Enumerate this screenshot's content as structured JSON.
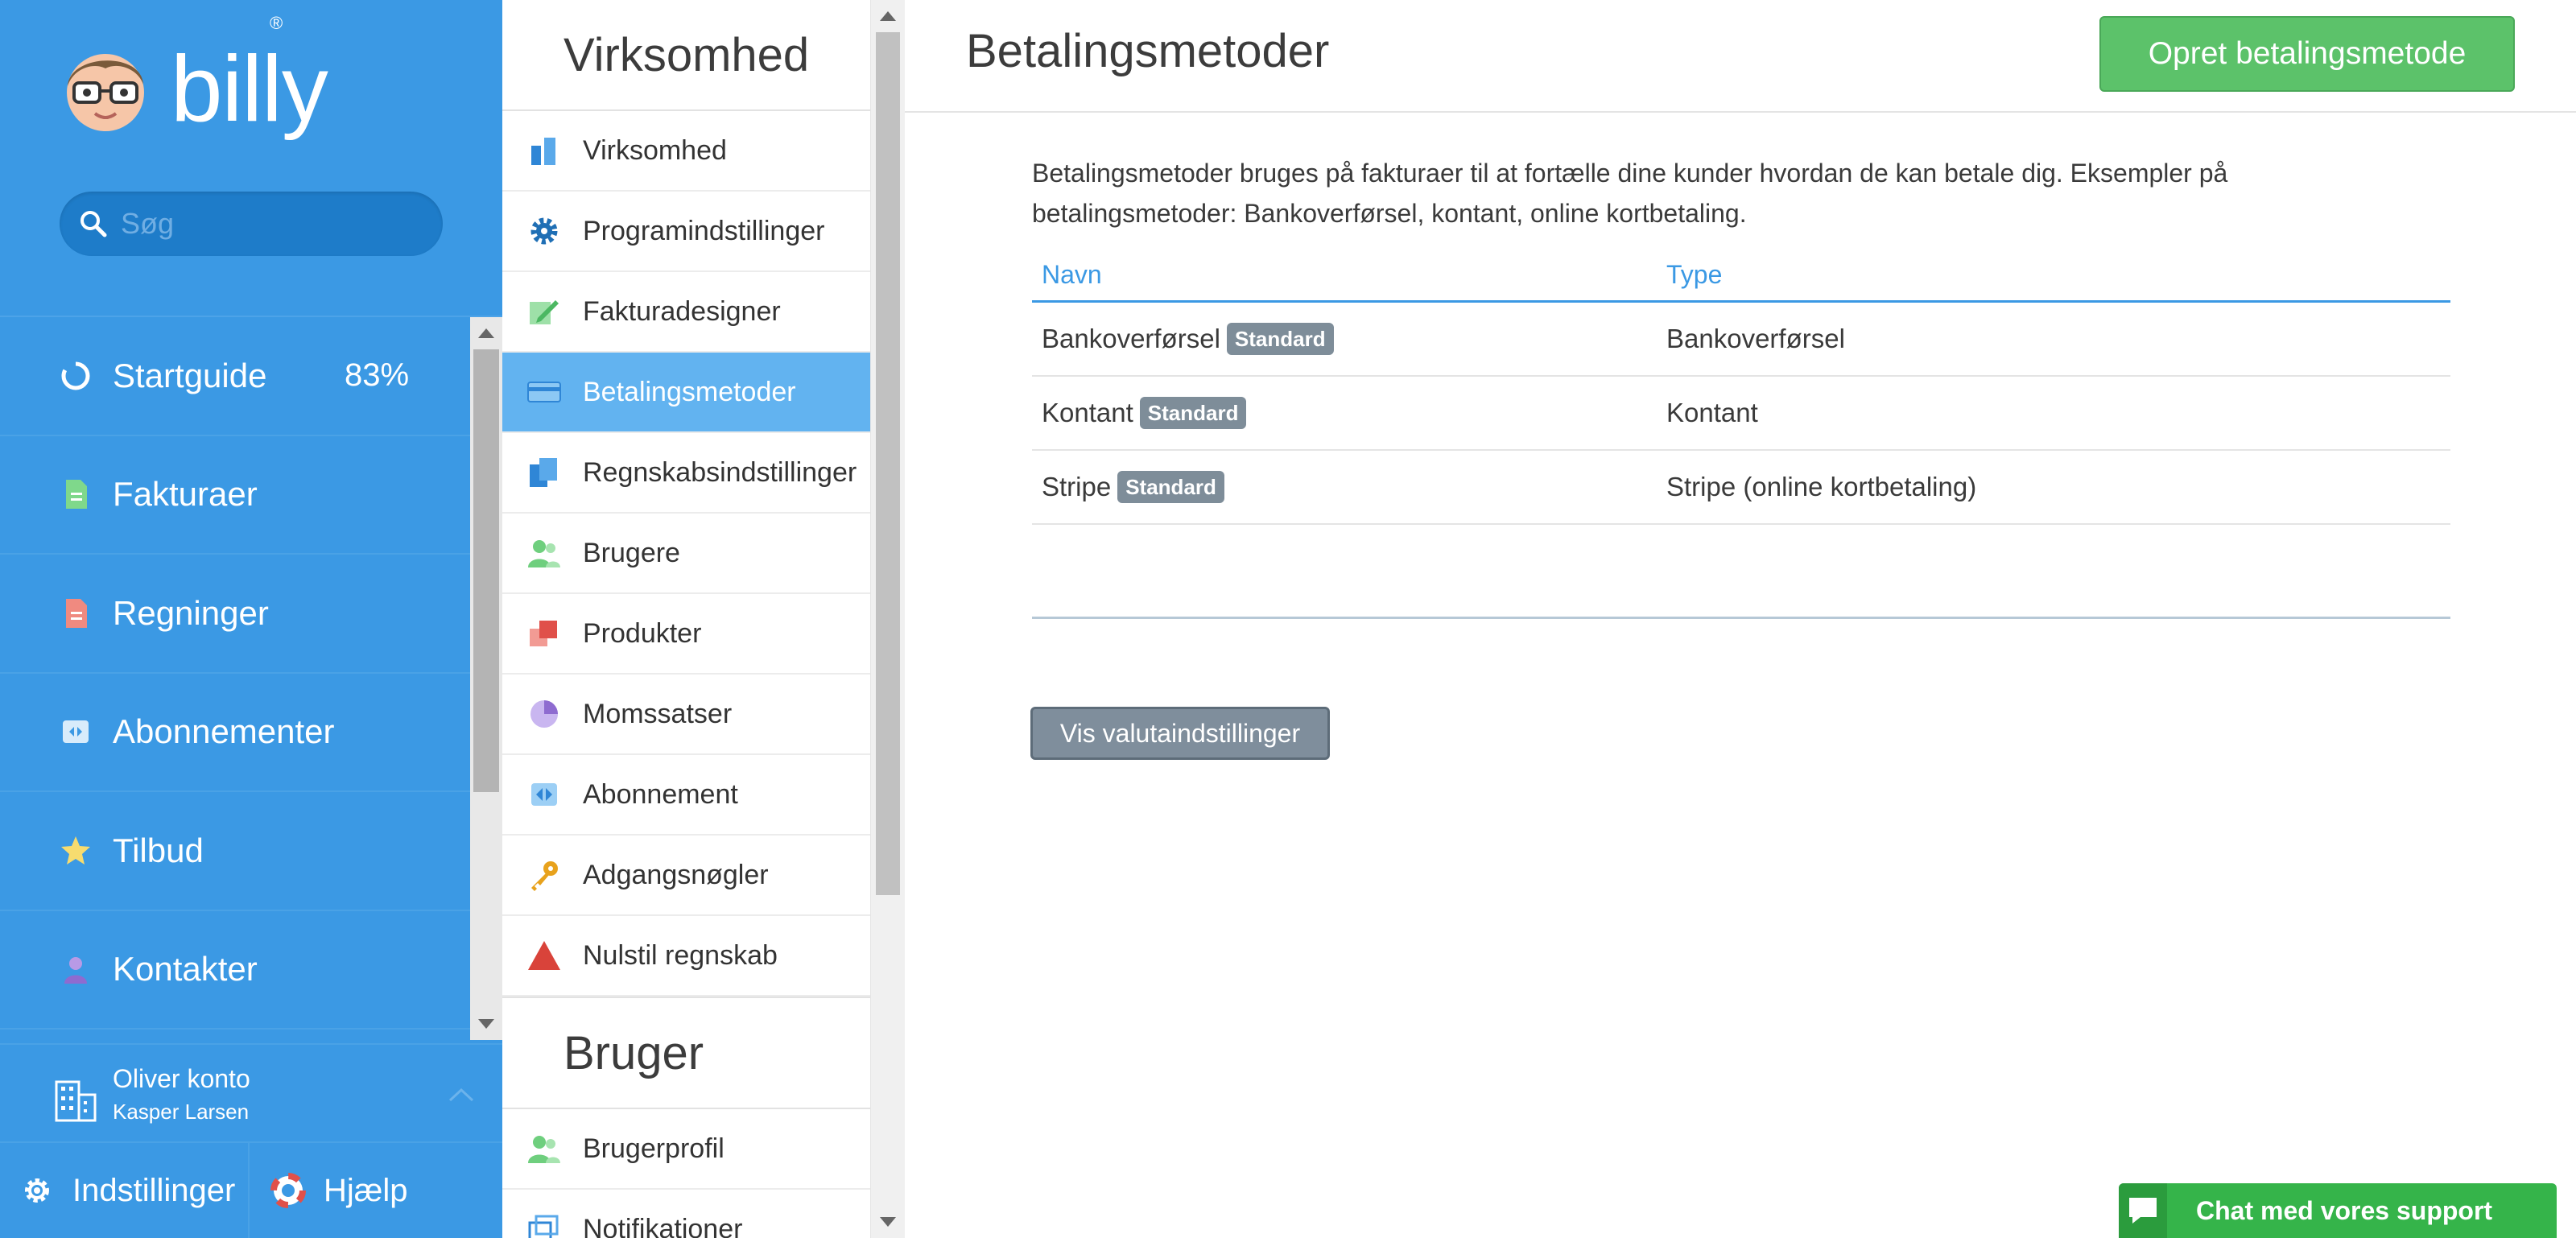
{
  "app": {
    "logo_text": "billy",
    "logo_reg": "®"
  },
  "search": {
    "placeholder": "Søg"
  },
  "sidebar": {
    "items": [
      {
        "label": "Startguide",
        "icon": "progress-ring-icon",
        "badge": "83%"
      },
      {
        "label": "Fakturaer",
        "icon": "invoice-icon"
      },
      {
        "label": "Regninger",
        "icon": "bill-icon"
      },
      {
        "label": "Abonnementer",
        "icon": "subscriptions-icon"
      },
      {
        "label": "Tilbud",
        "icon": "star-icon"
      },
      {
        "label": "Kontakter",
        "icon": "contact-icon"
      }
    ],
    "account": {
      "name": "Oliver konto",
      "user": "Kasper Larsen",
      "icon": "building-icon"
    },
    "settings_label": "Indstillinger",
    "help_label": "Hjælp"
  },
  "settings_menu": {
    "company_title": "Virksomhed",
    "company_items": [
      {
        "label": "Virksomhed",
        "icon": "company-icon",
        "color": "#2f86d6"
      },
      {
        "label": "Programindstillinger",
        "icon": "gear-icon",
        "color": "#1f6fb5"
      },
      {
        "label": "Fakturadesigner",
        "icon": "invoice-designer-icon",
        "color": "#4cb862"
      },
      {
        "label": "Betalingsmetoder",
        "icon": "card-icon",
        "color": "#2f86d6",
        "active": true
      },
      {
        "label": "Regnskabsindstillinger",
        "icon": "accounting-icon",
        "color": "#2f86d6"
      },
      {
        "label": "Brugere",
        "icon": "users-icon",
        "color": "#6fcf7e"
      },
      {
        "label": "Produkter",
        "icon": "products-icon",
        "color": "#e0504a"
      },
      {
        "label": "Momssatser",
        "icon": "pie-icon",
        "color": "#a889e0"
      },
      {
        "label": "Abonnement",
        "icon": "subscription-icon",
        "color": "#3b99e4"
      },
      {
        "label": "Adgangsnøgler",
        "icon": "key-icon",
        "color": "#e8a21c"
      },
      {
        "label": "Nulstil regnskab",
        "icon": "warning-icon",
        "color": "#d9433a"
      }
    ],
    "user_title": "Bruger",
    "user_items": [
      {
        "label": "Brugerprofil",
        "icon": "user-profile-icon",
        "color": "#6fcf7e"
      },
      {
        "label": "Notifikationer",
        "icon": "notifications-icon",
        "color": "#2f86d6"
      }
    ]
  },
  "main": {
    "title": "Betalingsmetoder",
    "create_button": "Opret betalingsmetode",
    "intro": "Betalingsmetoder bruges på fakturaer til at fortælle dine kunder hvordan de kan betale dig. Eksempler på betalingsmetoder: Bankoverførsel, kontant, online kortbetaling.",
    "table": {
      "columns": [
        "Navn",
        "Type"
      ],
      "rows": [
        {
          "name": "Bankoverførsel",
          "badge": "Standard",
          "type": "Bankoverførsel"
        },
        {
          "name": "Kontant",
          "badge": "Standard",
          "type": "Kontant"
        },
        {
          "name": "Stripe",
          "badge": "Standard",
          "type": "Stripe (online kortbetaling)"
        }
      ]
    },
    "currency_button": "Vis valutaindstillinger"
  },
  "chat": {
    "label": "Chat med vores support"
  },
  "colors": {
    "sidebar_bg": "#3b99e4",
    "accent": "#3b99e4",
    "active_menu": "#62b3f0",
    "green_button": "#5cc26a",
    "badge": "#7e8d99"
  }
}
